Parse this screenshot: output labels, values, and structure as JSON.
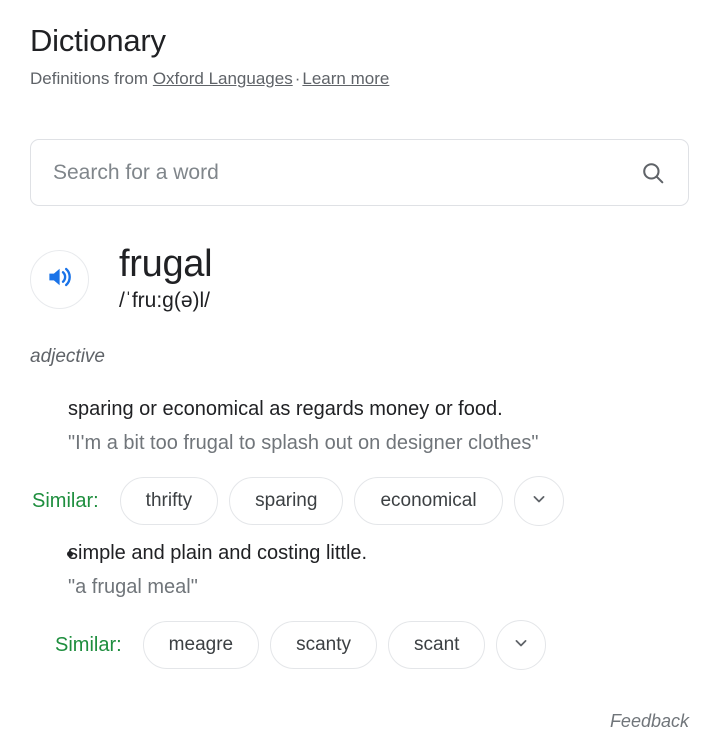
{
  "header": {
    "title": "Dictionary",
    "attribution_prefix": "Definitions from ",
    "source_link": "Oxford Languages",
    "separator": "·",
    "learn_more_link": "Learn more"
  },
  "search": {
    "placeholder": "Search for a word",
    "value": "",
    "icon": "search-icon"
  },
  "word": {
    "headword": "frugal",
    "phonetic": "/ˈfru:g(ə)l/",
    "speaker_icon": "speaker-volume-icon",
    "part_of_speech": "adjective"
  },
  "definitions": [
    {
      "text": "sparing or economical as regards money or food.",
      "example": "\"I'm a bit too frugal to splash out on designer clothes\"",
      "bulleted": false,
      "similar": {
        "label": "Similar:",
        "chips": [
          "thrifty",
          "sparing",
          "economical"
        ],
        "expand_icon": "chevron-down-icon"
      }
    },
    {
      "text": "simple and plain and costing little.",
      "example": "\"a frugal meal\"",
      "bulleted": true,
      "similar": {
        "label": "Similar:",
        "chips": [
          "meagre",
          "scanty",
          "scant"
        ],
        "expand_icon": "chevron-down-icon"
      }
    }
  ],
  "footer": {
    "feedback_label": "Feedback"
  },
  "colors": {
    "text_primary": "#202124",
    "text_secondary": "#5f6368",
    "text_muted": "#70757a",
    "similar_green": "#1e8e3e",
    "speaker_blue": "#1a73e8",
    "border": "#dfe1e5"
  }
}
